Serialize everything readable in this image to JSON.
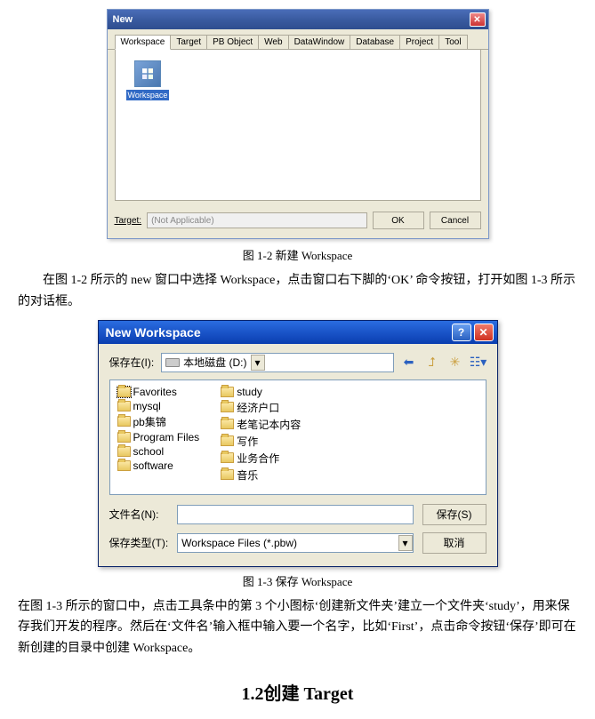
{
  "dialog1": {
    "title": "New",
    "tabs": [
      "Workspace",
      "Target",
      "PB Object",
      "Web",
      "DataWindow",
      "Database",
      "Project",
      "Tool"
    ],
    "item_label": "Workspace",
    "target_label": "Target:",
    "target_value": "(Not Applicable)",
    "ok": "OK",
    "cancel": "Cancel"
  },
  "caption1": "图 1-2  新建 Workspace",
  "para1": "在图 1-2 所示的 new 窗口中选择 Workspace，点击窗口右下脚的‘OK’ 命令按钮，打开如图 1-3 所示的对话框。",
  "dialog2": {
    "title": "New Workspace",
    "save_in_label": "保存在(I):",
    "save_in_value": "本地磁盘 (D:)",
    "folders_col1": [
      "Favorites",
      "mysql",
      "pb集锦",
      "Program Files",
      "school",
      "software"
    ],
    "folders_col2": [
      "study",
      "经济户口",
      "老笔记本内容",
      "写作",
      "业务合作",
      "音乐"
    ],
    "filename_label": "文件名(N):",
    "filename_value": "",
    "filetype_label": "保存类型(T):",
    "filetype_value": "Workspace Files (*.pbw)",
    "save_btn": "保存(S)",
    "cancel_btn": "取消"
  },
  "caption2": "图 1-3  保存 Workspace",
  "para2": "在图 1-3 所示的窗口中，点击工具条中的第 3 个小图标‘创建新文件夹’建立一个文件夹‘study’，用来保存我们开发的程序。然后在‘文件名’输入框中输入要一个名字，比如‘First’，点击命令按钮‘保存’即可在新创建的目录中创建 Workspace。",
  "section": "1.2创建 Target"
}
